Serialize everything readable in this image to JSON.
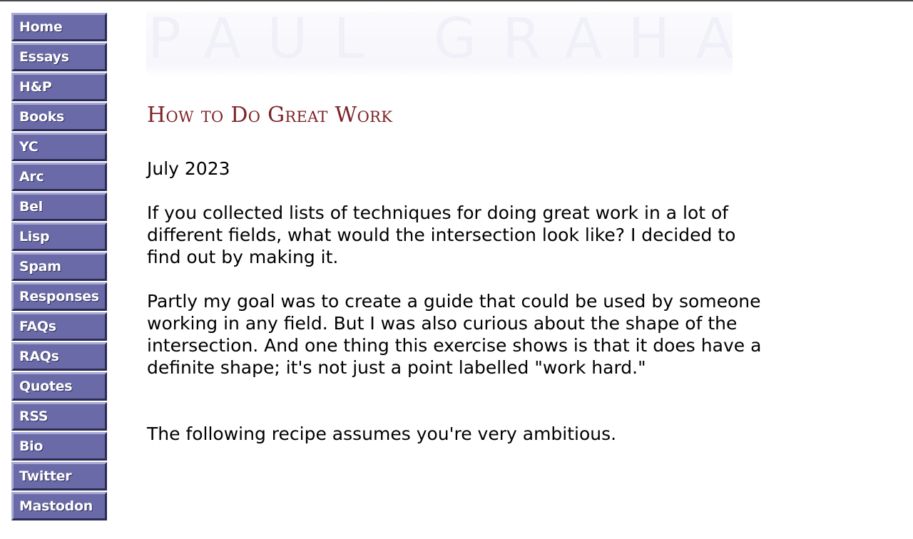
{
  "nav": {
    "items": [
      {
        "label": "Home"
      },
      {
        "label": "Essays"
      },
      {
        "label": "H&P"
      },
      {
        "label": "Books"
      },
      {
        "label": "YC"
      },
      {
        "label": "Arc"
      },
      {
        "label": "Bel"
      },
      {
        "label": "Lisp"
      },
      {
        "label": "Spam"
      },
      {
        "label": "Responses"
      },
      {
        "label": "FAQs"
      },
      {
        "label": "RAQs"
      },
      {
        "label": "Quotes"
      },
      {
        "label": "RSS"
      },
      {
        "label": "Bio"
      },
      {
        "label": "Twitter"
      },
      {
        "label": "Mastodon"
      }
    ]
  },
  "header": {
    "logo_text": "PAUL GRAHAM"
  },
  "article": {
    "title": "How to Do Great Work",
    "date": "July 2023",
    "paragraphs": [
      "If you collected lists of techniques for doing great work in a lot of different fields, what would the intersection look like? I decided to find out by making it.",
      "Partly my goal was to create a guide that could be used by someone working in any field. But I was also curious about the shape of the intersection. And one thing this exercise shows is that it does have a definite shape; it's not just a point labelled \"work hard.\"",
      "The following recipe assumes you're very ambitious."
    ]
  },
  "colors": {
    "nav_button": "#6a6aa8",
    "title": "#7d2428",
    "text": "#000000",
    "background": "#ffffff"
  }
}
